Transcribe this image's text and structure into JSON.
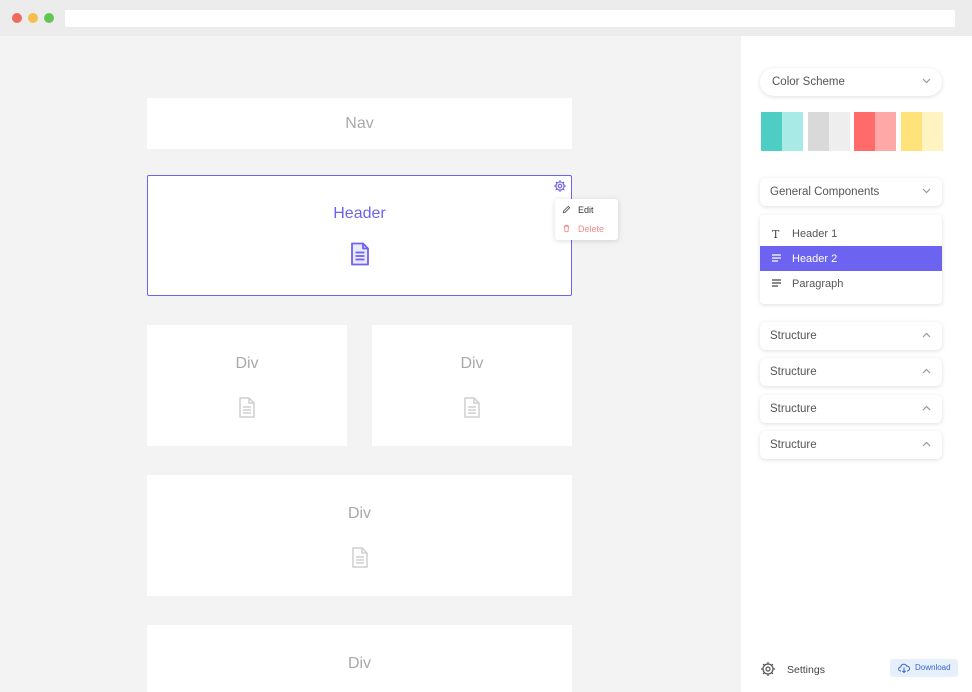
{
  "canvas": {
    "nav_label": "Nav",
    "header_label": "Header",
    "div_label": "Div",
    "context_menu": {
      "edit": "Edit",
      "delete": "Delete"
    }
  },
  "panel": {
    "color_scheme_label": "Color Scheme",
    "swatches": [
      {
        "left": "#4ecdc4",
        "right": "#a8ebe6"
      },
      {
        "left": "#d9d9d9",
        "right": "#eeeeee"
      },
      {
        "left": "#ff6b6b",
        "right": "#ffa8a8"
      },
      {
        "left": "#ffe27a",
        "right": "#fff3c2"
      }
    ],
    "general_components_label": "General Components",
    "components": [
      {
        "icon": "T",
        "label": "Header 1"
      },
      {
        "icon": "lines-icon",
        "label": "Header 2",
        "selected": true
      },
      {
        "icon": "lines-icon",
        "label": "Paragraph"
      }
    ],
    "structure_sections": [
      "Structure",
      "Structure",
      "Structure",
      "Structure"
    ],
    "settings_label": "Settings",
    "download_label": "Download"
  },
  "colors": {
    "accent": "#6c63f0",
    "delete": "#f28b8b",
    "canvas_bg": "#f3f3f3"
  }
}
